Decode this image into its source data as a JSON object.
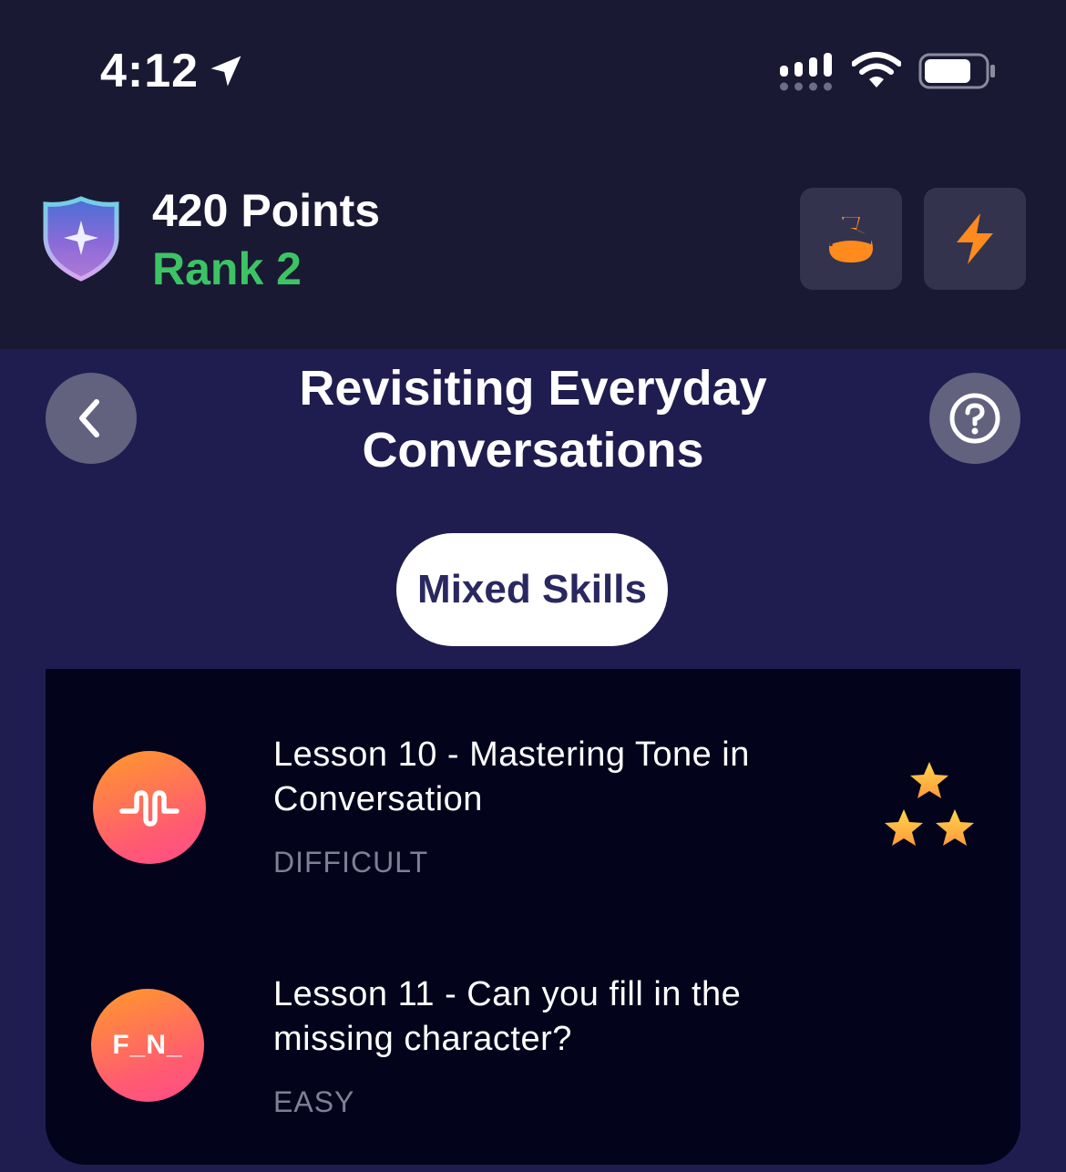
{
  "status_bar": {
    "time": "4:12",
    "icons": [
      "location-arrow-icon",
      "signal-icon",
      "wifi-icon",
      "battery-icon"
    ]
  },
  "header": {
    "points": "420 Points",
    "rank": "Rank 2",
    "badge_icon": "shield-icon",
    "buttons": [
      {
        "name": "potion-button",
        "icon": "potion-icon"
      },
      {
        "name": "bolt-button",
        "icon": "lightning-bolt-icon"
      }
    ]
  },
  "nav": {
    "title": "Revisiting Everyday Conversations",
    "back_icon": "chevron-left-icon",
    "help_icon": "question-mark-icon"
  },
  "category": {
    "label": "Mixed Skills"
  },
  "lessons": [
    {
      "title": "Lesson 10 - Mastering Tone in Conversation",
      "level": "DIFFICULT",
      "icon": "sound-wave-icon",
      "stars": 3
    },
    {
      "title": "Lesson 11 - Can you fill in the missing character?",
      "level": "EASY",
      "icon_text": "F_N_"
    }
  ],
  "colors": {
    "header_bg": "#1a1933",
    "page_bg": "#1f1d4f",
    "card_bg": "#03031c",
    "rank_green": "#3cc464",
    "accent_orange": "#ff8a1e",
    "level_gray": "#7f7f95"
  }
}
